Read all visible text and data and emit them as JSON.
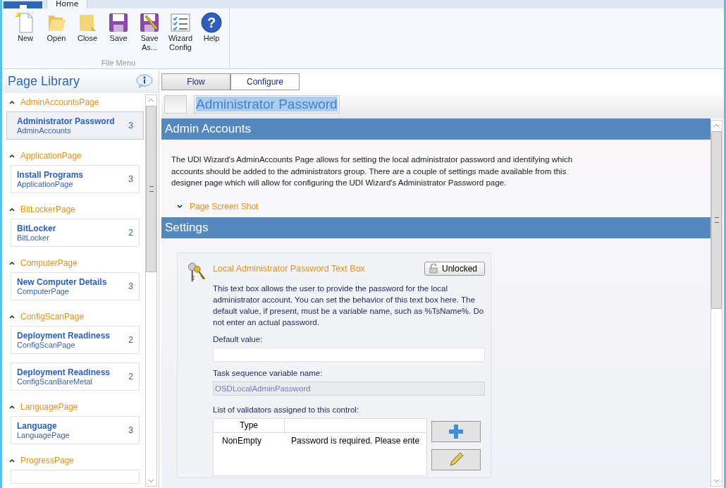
{
  "ribbon": {
    "tabs": [
      {
        "label": "Home",
        "selected": true
      }
    ],
    "buttons": [
      {
        "kind": "new",
        "label": "New"
      },
      {
        "kind": "open",
        "label": "Open"
      },
      {
        "kind": "close",
        "label": "Close"
      },
      {
        "kind": "save",
        "label": "Save"
      },
      {
        "kind": "saveas",
        "label": "Save As..."
      },
      {
        "kind": "wizard",
        "label": "Wizard Config"
      },
      {
        "kind": "help",
        "label": "Help",
        "glyph": "?"
      }
    ],
    "group_label": "File Menu"
  },
  "sidebar": {
    "title": "Page Library",
    "groups": [
      {
        "name": "AdminAccountsPage",
        "expanded": true,
        "items": [
          {
            "title": "Administrator Password",
            "subtitle": "AdminAccounts",
            "count": "3",
            "selected": true
          }
        ]
      },
      {
        "name": "ApplicationPage",
        "expanded": true,
        "items": [
          {
            "title": "Install Programs",
            "subtitle": "ApplicationPage",
            "count": "3",
            "selected": false
          }
        ]
      },
      {
        "name": "BitLockerPage",
        "expanded": true,
        "items": [
          {
            "title": "BitLocker",
            "subtitle": "BitLocker",
            "count": "2",
            "selected": false
          }
        ]
      },
      {
        "name": "ComputerPage",
        "expanded": true,
        "items": [
          {
            "title": "New Computer Details",
            "subtitle": "ComputerPage",
            "count": "3",
            "selected": false
          }
        ]
      },
      {
        "name": "ConfigScanPage",
        "expanded": true,
        "items": [
          {
            "title": "Deployment Readiness",
            "subtitle": "ConfigScanPage",
            "count": "2",
            "selected": false
          },
          {
            "title": "Deployment Readiness",
            "subtitle": "ConfigScanBareMetal",
            "count": "2",
            "selected": false
          }
        ]
      },
      {
        "name": "LanguagePage",
        "expanded": true,
        "items": [
          {
            "title": "Language",
            "subtitle": "LanguagePage",
            "count": "3",
            "selected": false
          }
        ]
      },
      {
        "name": "ProgressPage",
        "expanded": true
      }
    ]
  },
  "view_tabs": [
    {
      "label": "Flow",
      "selected": false
    },
    {
      "label": "Configure",
      "selected": true
    }
  ],
  "page_title": "Administrator Password",
  "sections": [
    {
      "kind": "about",
      "title": "Admin Accounts",
      "text": "The UDI Wizard's AdminAccounts Page allows for setting the local administrator password and identifying which accounts should be added to the administrators group. There are a couple of settings made available from this designer page which will allow for configuring the UDI Wizard's Administrator Password page.",
      "expander": {
        "label": "Page Screen Shot",
        "expanded": false
      }
    },
    {
      "kind": "settings",
      "title": "Settings",
      "setting": {
        "title": "Local Administrator Password Text Box",
        "lock": {
          "label": "Unlocked",
          "locked": false
        },
        "text": "This text box allows the user to provide the password for the local administrator account. You can set the behavior of this text box here. The default value, if present, must be a variable name, such as %TsName%. Do not enter an actual password.",
        "fields": [
          {
            "label": "Default value:",
            "disabled": false
          },
          {
            "label": "Task sequence variable name:",
            "value": "OSDLocalAdminPassword",
            "disabled": true
          }
        ],
        "validators": {
          "label": "List of validators assigned to this control:",
          "columns": [
            "Type"
          ],
          "rows": [
            {
              "type": "NonEmpty",
              "message": "Password is required. Please ente"
            }
          ]
        }
      }
    }
  ]
}
